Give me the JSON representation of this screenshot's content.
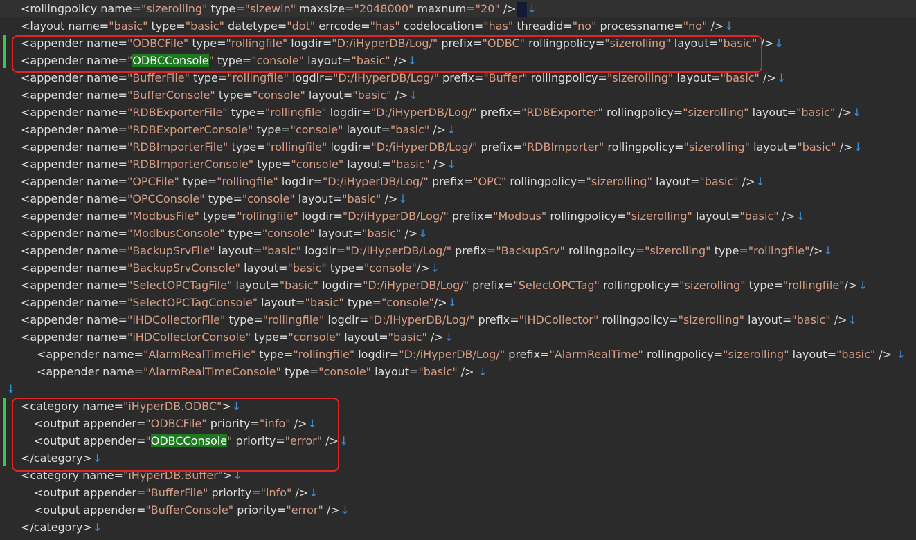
{
  "editor": {
    "lines": [
      {
        "text": "<rollingpolicy name=\"sizerolling\" type=\"sizewin\" maxsize=\"2048000\" maxnum=\"20\" />",
        "caret": true
      },
      {
        "text": "<layout name=\"basic\" type=\"basic\" datetype=\"dot\" errcode=\"has\" codelocation=\"has\" threadid=\"no\" processname=\"no\" />"
      },
      {
        "text": "<appender name=\"ODBCFile\" type=\"rollingfile\" logdir=\"D:/iHyperDB/Log/\" prefix=\"ODBC\" rollingpolicy=\"sizerolling\" layout=\"basic\" />"
      },
      {
        "text": "<appender name=\"ODBCConsole\" type=\"console\" layout=\"basic\" />",
        "highlight": "ODBCConsole"
      },
      {
        "text": "<appender name=\"BufferFile\" type=\"rollingfile\" logdir=\"D:/iHyperDB/Log/\" prefix=\"Buffer\" rollingpolicy=\"sizerolling\" layout=\"basic\" />"
      },
      {
        "text": "<appender name=\"BufferConsole\" type=\"console\" layout=\"basic\" />"
      },
      {
        "text": "<appender name=\"RDBExporterFile\" type=\"rollingfile\" logdir=\"D:/iHyperDB/Log/\" prefix=\"RDBExporter\" rollingpolicy=\"sizerolling\" layout=\"basic\" />"
      },
      {
        "text": "<appender name=\"RDBExporterConsole\" type=\"console\" layout=\"basic\" />"
      },
      {
        "text": "<appender name=\"RDBImporterFile\" type=\"rollingfile\" logdir=\"D:/iHyperDB/Log/\" prefix=\"RDBImporter\" rollingpolicy=\"sizerolling\" layout=\"basic\" />"
      },
      {
        "text": "<appender name=\"RDBImporterConsole\" type=\"console\" layout=\"basic\" />"
      },
      {
        "text": "<appender name=\"OPCFile\" type=\"rollingfile\" logdir=\"D:/iHyperDB/Log/\" prefix=\"OPC\" rollingpolicy=\"sizerolling\" layout=\"basic\" />"
      },
      {
        "text": "<appender name=\"OPCConsole\" type=\"console\" layout=\"basic\" />"
      },
      {
        "text": "<appender name=\"ModbusFile\" type=\"rollingfile\" logdir=\"D:/iHyperDB/Log/\" prefix=\"Modbus\" rollingpolicy=\"sizerolling\" layout=\"basic\" />"
      },
      {
        "text": "<appender name=\"ModbusConsole\" type=\"console\" layout=\"basic\" />"
      },
      {
        "text": "<appender name=\"BackupSrvFile\" layout=\"basic\" logdir=\"D:/iHyperDB/Log/\" prefix=\"BackupSrv\" rollingpolicy=\"sizerolling\" type=\"rollingfile\"/>"
      },
      {
        "text": "<appender name=\"BackupSrvConsole\" layout=\"basic\" type=\"console\"/>"
      },
      {
        "text": "<appender name=\"SelectOPCTagFile\" layout=\"basic\" logdir=\"D:/iHyperDB/Log/\" prefix=\"SelectOPCTag\" rollingpolicy=\"sizerolling\" type=\"rollingfile\"/>"
      },
      {
        "text": "<appender name=\"SelectOPCTagConsole\" layout=\"basic\" type=\"console\"/>"
      },
      {
        "text": "<appender name=\"iHDCollectorFile\" type=\"rollingfile\" logdir=\"D:/iHyperDB/Log/\" prefix=\"iHDCollector\" rollingpolicy=\"sizerolling\" layout=\"basic\" />"
      },
      {
        "text": "<appender name=\"iHDCollectorConsole\" type=\"console\" layout=\"basic\" />"
      },
      {
        "text": "<appender name=\"AlarmRealTimeFile\" type=\"rollingfile\" logdir=\"D:/iHyperDB/Log/\" prefix=\"AlarmRealTime\" rollingpolicy=\"sizerolling\" layout=\"basic\" /> ",
        "indent": 2
      },
      {
        "text": "<appender name=\"AlarmRealTimeConsole\" type=\"console\" layout=\"basic\" /> ",
        "indent": 2
      },
      {
        "text": "",
        "indent": -1
      },
      {
        "text": "<category name=\"iHyperDB.ODBC\">"
      },
      {
        "text": "<output appender=\"ODBCFile\" priority=\"info\" />",
        "indent": 1
      },
      {
        "text": "<output appender=\"ODBCConsole\" priority=\"error\" />",
        "indent": 1,
        "highlight": "ODBCConsole"
      },
      {
        "text": "</category>"
      },
      {
        "text": "<category name=\"iHyperDB.Buffer\">"
      },
      {
        "text": "<output appender=\"BufferFile\" priority=\"info\" />",
        "indent": 1
      },
      {
        "text": "<output appender=\"BufferConsole\" priority=\"error\" />",
        "indent": 1
      },
      {
        "text": "</category>"
      }
    ],
    "eol_glyph": "↓",
    "colors": {
      "background": "#2b2b2b",
      "text": "#dcdcdc",
      "string": "#d69d85",
      "highlight": "#1e7a1e",
      "eol": "#3c8ed8",
      "box": "#e02323",
      "change_bar": "#3ac84a"
    }
  }
}
